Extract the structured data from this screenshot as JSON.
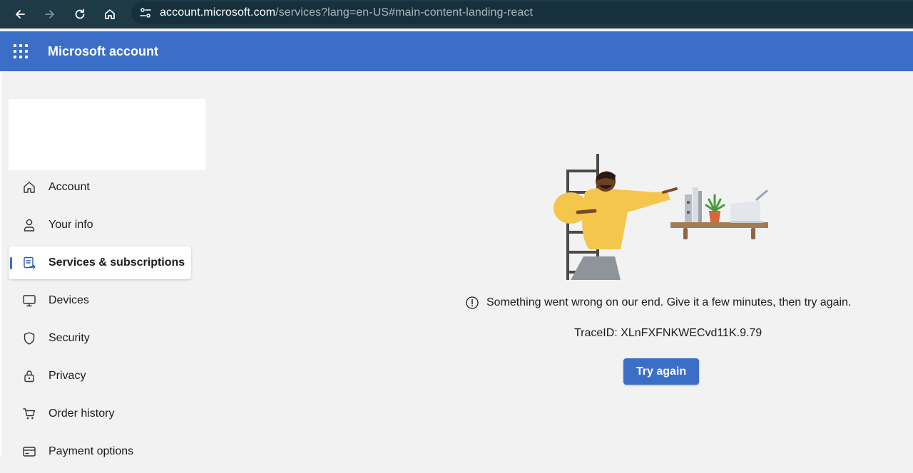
{
  "browser": {
    "url_host": "account.microsoft.com",
    "url_path": "/services?lang=en-US#main-content-landing-react",
    "icons": [
      "back-icon",
      "forward-icon",
      "reload-icon",
      "home-icon",
      "site-info-icon"
    ]
  },
  "header": {
    "title": "Microsoft account",
    "accent": "#3b6ec7"
  },
  "sidebar": {
    "items": [
      {
        "label": "Account",
        "icon": "home-icon"
      },
      {
        "label": "Your info",
        "icon": "person-icon"
      },
      {
        "label": "Services & subscriptions",
        "icon": "subscriptions-icon",
        "active": true
      },
      {
        "label": "Devices",
        "icon": "monitor-icon"
      },
      {
        "label": "Security",
        "icon": "shield-icon"
      },
      {
        "label": "Privacy",
        "icon": "lock-icon"
      },
      {
        "label": "Order history",
        "icon": "cart-icon"
      },
      {
        "label": "Payment options",
        "icon": "card-icon"
      }
    ]
  },
  "main": {
    "error_message": "Something went wrong on our end. Give it a few minutes, then try again.",
    "trace_id": "TraceID: XLnFXFNKWECvd11K.9.79",
    "try_again_label": "Try again"
  }
}
